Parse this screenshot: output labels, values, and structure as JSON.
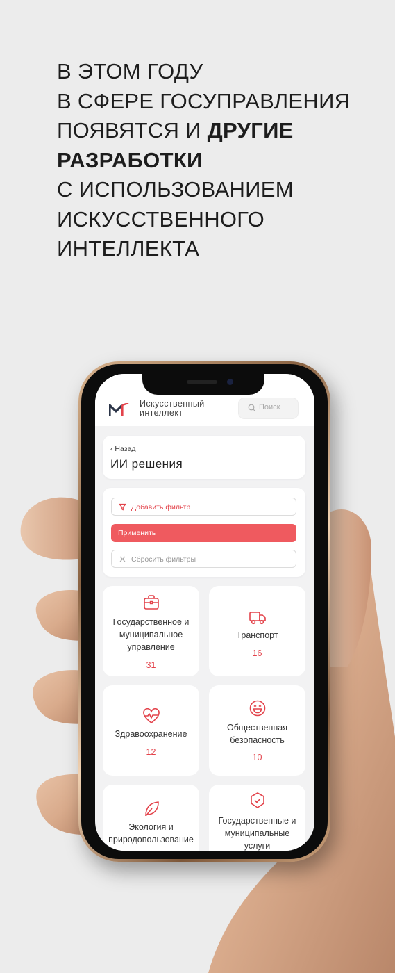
{
  "headline": {
    "line1": "В ЭТОМ ГОДУ",
    "line2": "В СФЕРЕ ГОСУПРАВЛЕНИЯ",
    "line3_prefix": "ПОЯВЯТСЯ И",
    "line3_bold": "ДРУГИЕ",
    "line4_bold": "РАЗРАБОТКИ",
    "line5": "С ИСПОЛЬЗОВАНИЕМ",
    "line6": "ИСКУССТВЕННОГО",
    "line7": "ИНТЕЛЛЕКТА"
  },
  "app": {
    "brand_line1": "Искусственный",
    "brand_line2": "интеллект",
    "search_placeholder": "Поиск",
    "back_label": "Назад",
    "page_title": "ИИ решения",
    "add_filter_label": "Добавить фильтр",
    "apply_label": "Применить",
    "reset_label": "Сбросить фильтры",
    "accent_color": "#ef5a5f"
  },
  "categories": [
    {
      "name": "Государственное и муниципальное управление",
      "count": "31",
      "icon": "briefcase-icon"
    },
    {
      "name": "Транспорт",
      "count": "16",
      "icon": "truck-icon"
    },
    {
      "name": "Здравоохранение",
      "count": "12",
      "icon": "heart-pulse-icon"
    },
    {
      "name": "Общественная безопасность",
      "count": "10",
      "icon": "smile-icon"
    },
    {
      "name": "Экология и природопользование",
      "count": "",
      "icon": "leaf-icon"
    },
    {
      "name": "Государственные и муниципальные услуги",
      "count": "",
      "icon": "shield-check-icon"
    }
  ]
}
